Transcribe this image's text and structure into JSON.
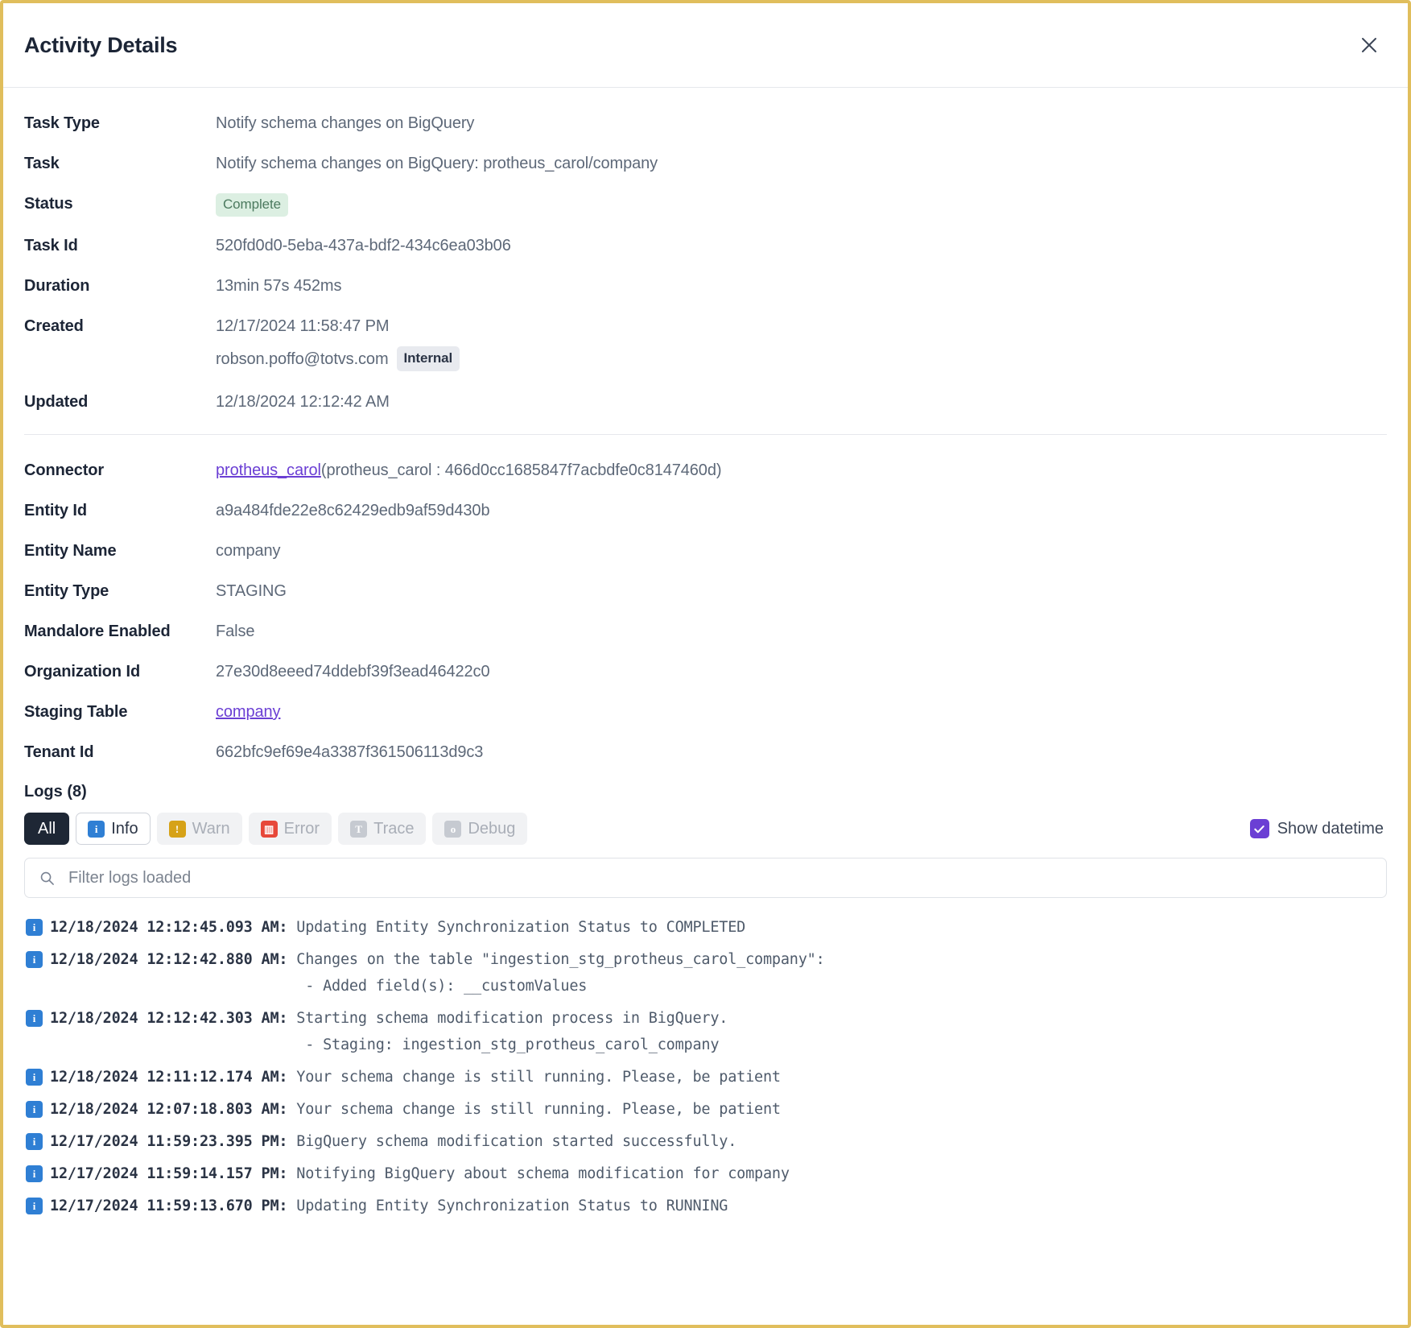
{
  "header": {
    "title": "Activity Details",
    "close_label": "×"
  },
  "details": [
    {
      "label": "Task Type",
      "value": "Notify schema changes on BigQuery"
    },
    {
      "label": "Task",
      "value": "Notify schema changes on BigQuery: protheus_carol/company"
    },
    {
      "label": "Status",
      "value": "Complete"
    },
    {
      "label": "Task Id",
      "value": "520fd0d0-5eba-437a-bdf2-434c6ea03b06"
    },
    {
      "label": "Duration",
      "value": "13min 57s 452ms"
    },
    {
      "label": "Created",
      "value": "12/17/2024 11:58:47 PM"
    },
    {
      "label": "Updated",
      "value": "12/18/2024 12:12:42 AM"
    }
  ],
  "created_user": {
    "email": "robson.poffo@totvs.com",
    "badge": "Internal"
  },
  "status_badge": "Complete",
  "entity": [
    {
      "label": "Connector",
      "link_text": "protheus_carol",
      "value": "(protheus_carol : 466d0cc1685847f7acbdfe0c8147460d)"
    },
    {
      "label": "Entity Id",
      "value": "a9a484fde22e8c62429edb9af59d430b"
    },
    {
      "label": "Entity Name",
      "value": "company"
    },
    {
      "label": "Entity Type",
      "value": "STAGING"
    },
    {
      "label": "Mandalore Enabled",
      "value": "False"
    },
    {
      "label": "Organization Id",
      "value": "27e30d8eeed74ddebf39f3ead46422c0"
    },
    {
      "label": "Staging Table",
      "link_text": "company",
      "value": ""
    },
    {
      "label": "Tenant Id",
      "value": "662bfc9ef69e4a3387f361506113d9c3"
    }
  ],
  "logs": {
    "title": "Logs (8)",
    "filters": [
      {
        "label": "All",
        "icon": "",
        "state": "active-dark"
      },
      {
        "label": "Info",
        "icon": "i",
        "state": "active-outline"
      },
      {
        "label": "Warn",
        "icon": "!",
        "state": "inactive"
      },
      {
        "label": "Error",
        "icon": "▥",
        "state": "inactive"
      },
      {
        "label": "Trace",
        "icon": "T",
        "state": "inactive"
      },
      {
        "label": "Debug",
        "icon": "o",
        "state": "inactive"
      }
    ],
    "show_datetime_label": "Show datetime",
    "show_datetime_checked": true,
    "search_placeholder": "Filter logs loaded",
    "search_value": "",
    "entries": [
      {
        "level": "info",
        "timestamp": "12/18/2024 12:12:45.093 AM:",
        "message": "Updating Entity Synchronization Status to COMPLETED"
      },
      {
        "level": "info",
        "timestamp": "12/18/2024 12:12:42.880 AM:",
        "message": "Changes on the table \"ingestion_stg_protheus_carol_company\":\n                             - Added field(s): __customValues"
      },
      {
        "level": "info",
        "timestamp": "12/18/2024 12:12:42.303 AM:",
        "message": "Starting schema modification process in BigQuery.\n                             - Staging: ingestion_stg_protheus_carol_company"
      },
      {
        "level": "info",
        "timestamp": "12/18/2024 12:11:12.174 AM:",
        "message": "Your schema change is still running. Please, be patient"
      },
      {
        "level": "info",
        "timestamp": "12/18/2024 12:07:18.803 AM:",
        "message": "Your schema change is still running. Please, be patient"
      },
      {
        "level": "info",
        "timestamp": "12/17/2024 11:59:23.395 PM:",
        "message": "BigQuery schema modification started successfully."
      },
      {
        "level": "info",
        "timestamp": "12/17/2024 11:59:14.157 PM:",
        "message": "Notifying BigQuery about schema modification for company"
      },
      {
        "level": "info",
        "timestamp": "12/17/2024 11:59:13.670 PM:",
        "message": "Updating Entity Synchronization Status to RUNNING"
      }
    ]
  },
  "colors": {
    "modal_border": "#e0be5c",
    "link": "#6b3fd4",
    "status_badge_bg": "#dcefe2",
    "status_badge_fg": "#4c7a5f",
    "checkbox": "#6b3fd4",
    "info": "#2f7fd4",
    "warn": "#d6a218",
    "error": "#e7483a",
    "trace": "#c6cad1",
    "debug": "#c6cad1"
  }
}
